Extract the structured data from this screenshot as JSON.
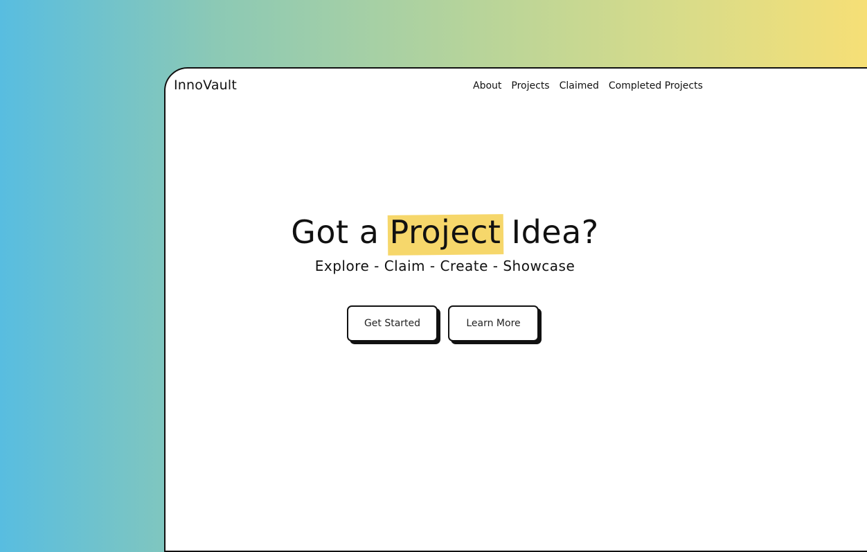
{
  "brand": "InnoVault",
  "nav": [
    "About",
    "Projects",
    "Claimed",
    "Completed Projects"
  ],
  "hero": {
    "headline_pre": "Got a ",
    "headline_highlight": "Project",
    "headline_post": " Idea?",
    "tagline": "Explore - Claim - Create - Showcase"
  },
  "buttons": {
    "primary": "Get Started",
    "secondary": "Learn More"
  },
  "colors": {
    "highlight": "#f6d76b",
    "gradient_start": "#58bde0",
    "gradient_end": "#f6df76"
  }
}
